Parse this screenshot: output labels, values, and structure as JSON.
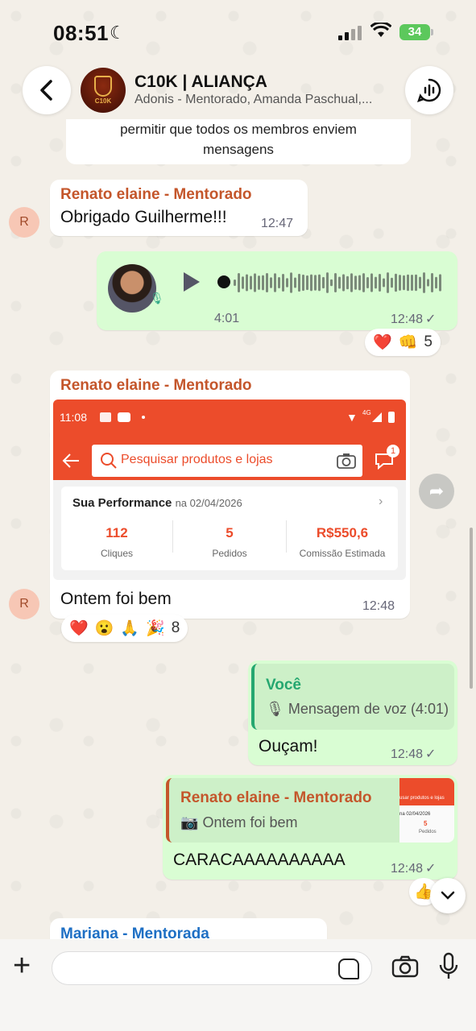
{
  "status": {
    "time": "08:51",
    "battery": "34"
  },
  "header": {
    "title": "C10K | ALIANÇA",
    "subtitle": "Adonis - Mentorado, Amanda Paschual,...",
    "avatar_text": "C10K"
  },
  "system_notice": {
    "line1": "permitir que todos os membros enviem",
    "line2": "mensagens"
  },
  "messages": {
    "m1": {
      "sender": "Renato elaine - Mentorado",
      "text": "Obrigado Guilherme!!!",
      "time": "12:47",
      "avatar_letter": "R"
    },
    "voice": {
      "duration": "4:01",
      "time": "12:48",
      "reactions": [
        "❤️",
        "👊"
      ],
      "reaction_count": "5"
    },
    "m3": {
      "sender": "Renato elaine - Mentorado",
      "text": "Ontem foi bem",
      "time": "12:48",
      "avatar_letter": "R",
      "reactions": [
        "❤️",
        "😮",
        "🙏",
        "🎉"
      ],
      "reaction_count": "8",
      "image": {
        "time": "11:08",
        "network": "4G",
        "search_placeholder": "Pesquisar produtos e lojas",
        "badge": "1",
        "perf_title": "Sua Performance",
        "perf_date": "na 02/04/2026",
        "stats": [
          {
            "value": "112",
            "label": "Cliques"
          },
          {
            "value": "5",
            "label": "Pedidos"
          },
          {
            "value": "R$550,6",
            "label": "Comissão Estimada"
          }
        ]
      }
    },
    "m4": {
      "quote_sender": "Você",
      "quote_text": "Mensagem de voz (4:01)",
      "text": "Ouçam!",
      "time": "12:48"
    },
    "m5": {
      "quote_sender": "Renato elaine - Mentorado",
      "quote_text": "Ontem foi bem",
      "text": "CARACAAAAAAAAAA",
      "time": "12:48",
      "reaction": "👍",
      "thumb_text": "usar produtos e lojas",
      "thumb_date": "na 02/04/2026",
      "thumb_value": "5",
      "thumb_label": "Pedidos"
    },
    "m6": {
      "sender": "Mariana - Mentorada"
    }
  },
  "colors": {
    "accent": "#25a770",
    "sender_orange": "#c4562b",
    "shopee": "#ec4c2b",
    "outgoing": "#d9fdd3"
  }
}
